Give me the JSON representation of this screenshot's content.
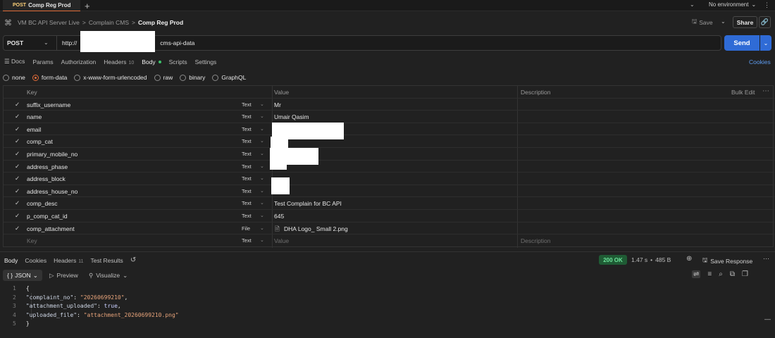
{
  "top_tab": {
    "method": "POST",
    "name": "Comp Reg Prod",
    "plus": "+"
  },
  "env": {
    "label": "No environment",
    "caret": "⌄"
  },
  "breadcrumb": {
    "items": [
      "VM BC API Server Live",
      "Complain CMS"
    ],
    "separator": ">",
    "current": "Comp Reg Prod"
  },
  "header_actions": {
    "save": "Save",
    "share": "Share"
  },
  "request": {
    "method": "POST",
    "url_prefix": "http://",
    "url_suffix": "cms-api-data",
    "send": "Send"
  },
  "req_tabs": [
    {
      "label": "Docs"
    },
    {
      "label": "Params"
    },
    {
      "label": "Authorization"
    },
    {
      "label": "Headers",
      "count": "10"
    },
    {
      "label": "Body"
    },
    {
      "label": "Scripts"
    },
    {
      "label": "Settings"
    }
  ],
  "cookies_link": "Cookies",
  "body_types": [
    "none",
    "form-data",
    "x-www-form-urlencoded",
    "raw",
    "binary",
    "GraphQL"
  ],
  "table": {
    "headers": {
      "key": "Key",
      "value": "Value",
      "description": "Description",
      "bulk_edit": "Bulk Edit"
    },
    "rows": [
      {
        "key": "suffix_username",
        "type": "Text",
        "value": "Mr"
      },
      {
        "key": "name",
        "type": "Text",
        "value": "Umair Qasim"
      },
      {
        "key": "email",
        "type": "Text",
        "value": ""
      },
      {
        "key": "comp_cat",
        "type": "Text",
        "value": ""
      },
      {
        "key": "primary_mobile_no",
        "type": "Text",
        "value": ""
      },
      {
        "key": "address_phase",
        "type": "Text",
        "value": ""
      },
      {
        "key": "address_block",
        "type": "Text",
        "value": ""
      },
      {
        "key": "address_house_no",
        "type": "Text",
        "value": ""
      },
      {
        "key": "comp_desc",
        "type": "Text",
        "value": "Test Complain for BC API"
      },
      {
        "key": "p_comp_cat_id",
        "type": "Text",
        "value": "645"
      },
      {
        "key": "comp_attachment",
        "type": "File",
        "value": "DHA Logo_ Small 2.png"
      }
    ],
    "placeholder": {
      "key": "Key",
      "type": "Text",
      "value": "Value",
      "description": "Description"
    }
  },
  "response": {
    "tabs": [
      {
        "label": "Body"
      },
      {
        "label": "Cookies"
      },
      {
        "label": "Headers",
        "count": "11"
      },
      {
        "label": "Test Results"
      }
    ],
    "status": "200 OK",
    "time": "1.47 s",
    "size": "485 B",
    "save_response": "Save Response",
    "format": "JSON",
    "preview": "Preview",
    "visualize": "Visualize",
    "code_lines": [
      "1",
      "2",
      "3",
      "4",
      "5"
    ],
    "json": {
      "open": "{",
      "close": "}",
      "complaint_no_key": "\"complaint_no\"",
      "complaint_no_val": "\"20260699210\"",
      "attachment_key": "\"attachment_uploaded\"",
      "attachment_val": "true",
      "uploaded_key": "\"uploaded_file\"",
      "uploaded_val": "\"attachment_20260699210.png\""
    }
  },
  "colors": {
    "accent": "#e06c3a",
    "send": "#2f6bd6",
    "status_bg": "#1f5b34",
    "status_fg": "#6be39a"
  }
}
